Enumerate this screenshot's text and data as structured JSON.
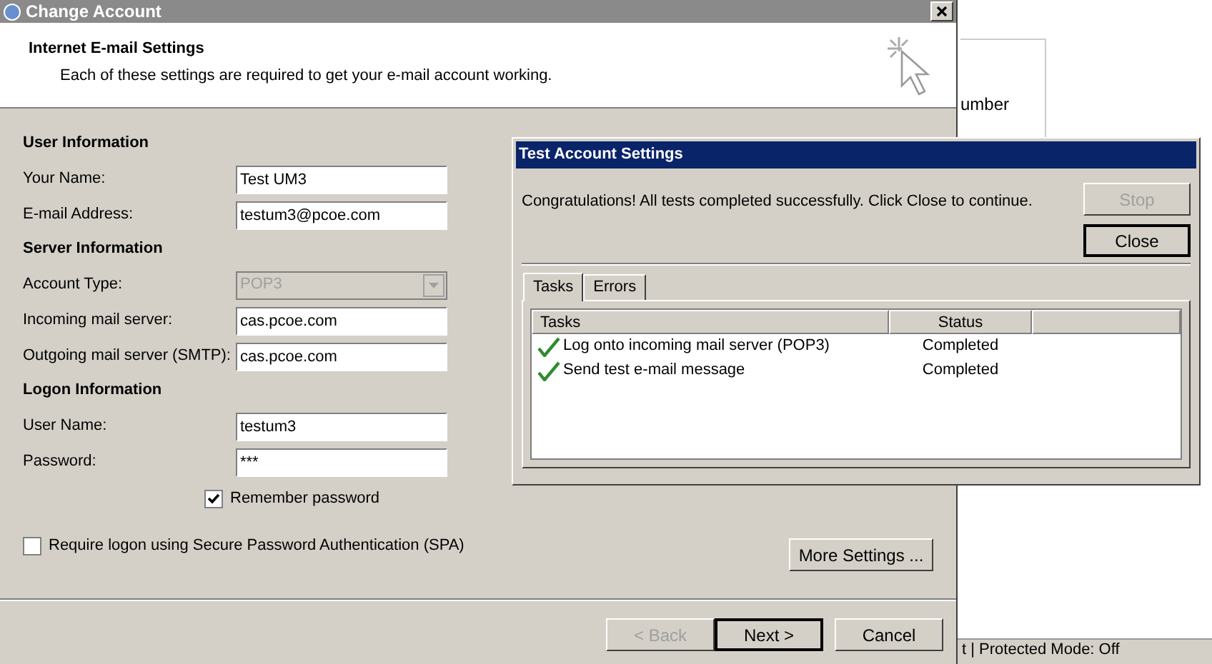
{
  "main_window": {
    "title": "Change Account",
    "header": {
      "title": "Internet E-mail Settings",
      "subtitle": "Each of these settings are required to get your e-mail account working."
    },
    "sections": [
      {
        "heading": "User Information",
        "fields": [
          {
            "kind": "text",
            "label": "Your Name:",
            "value": "Test UM3",
            "disabled": false
          },
          {
            "kind": "text",
            "label": "E-mail Address:",
            "value": "testum3@pcoe.com",
            "disabled": false
          }
        ]
      },
      {
        "heading": "Server Information",
        "fields": [
          {
            "kind": "dropdown",
            "label": "Account Type:",
            "value": "POP3",
            "disabled": true
          },
          {
            "kind": "text",
            "label": "Incoming mail server:",
            "value": "cas.pcoe.com",
            "disabled": false
          },
          {
            "kind": "text",
            "label": "Outgoing mail server (SMTP):",
            "value": "cas.pcoe.com",
            "disabled": false
          }
        ]
      },
      {
        "heading": "Logon Information",
        "fields": [
          {
            "kind": "text",
            "label": "User Name:",
            "value": "testum3",
            "disabled": false
          },
          {
            "kind": "text",
            "label": "Password:",
            "value": "***",
            "disabled": false
          }
        ]
      }
    ],
    "remember_password": {
      "label": "Remember password",
      "checked": true
    },
    "spa": {
      "label": "Require logon using Secure Password Authentication (SPA)",
      "checked": false
    },
    "more_settings": "More Settings ...",
    "buttons": [
      {
        "label": "< Back",
        "disabled": true,
        "default": false
      },
      {
        "label": "Next >",
        "disabled": false,
        "default": true
      },
      {
        "label": "Cancel",
        "disabled": false,
        "default": false
      }
    ]
  },
  "background": {
    "text": "umber",
    "status_bar": "t | Protected Mode: Off"
  },
  "test_dialog": {
    "title": "Test Account Settings",
    "message": "Congratulations! All tests completed successfully. Click Close to continue.",
    "buttons": [
      {
        "label": "Stop",
        "disabled": true,
        "default": false
      },
      {
        "label": "Close",
        "disabled": false,
        "default": true
      }
    ],
    "tabs": [
      {
        "label": "Tasks",
        "selected": true
      },
      {
        "label": "Errors",
        "selected": false
      }
    ],
    "columns": [
      "Tasks",
      "Status"
    ],
    "rows": [
      {
        "task": "Log onto incoming mail server (POP3)",
        "status": "Completed",
        "done": true
      },
      {
        "task": "Send test e-mail message",
        "status": "Completed",
        "done": true
      }
    ]
  }
}
